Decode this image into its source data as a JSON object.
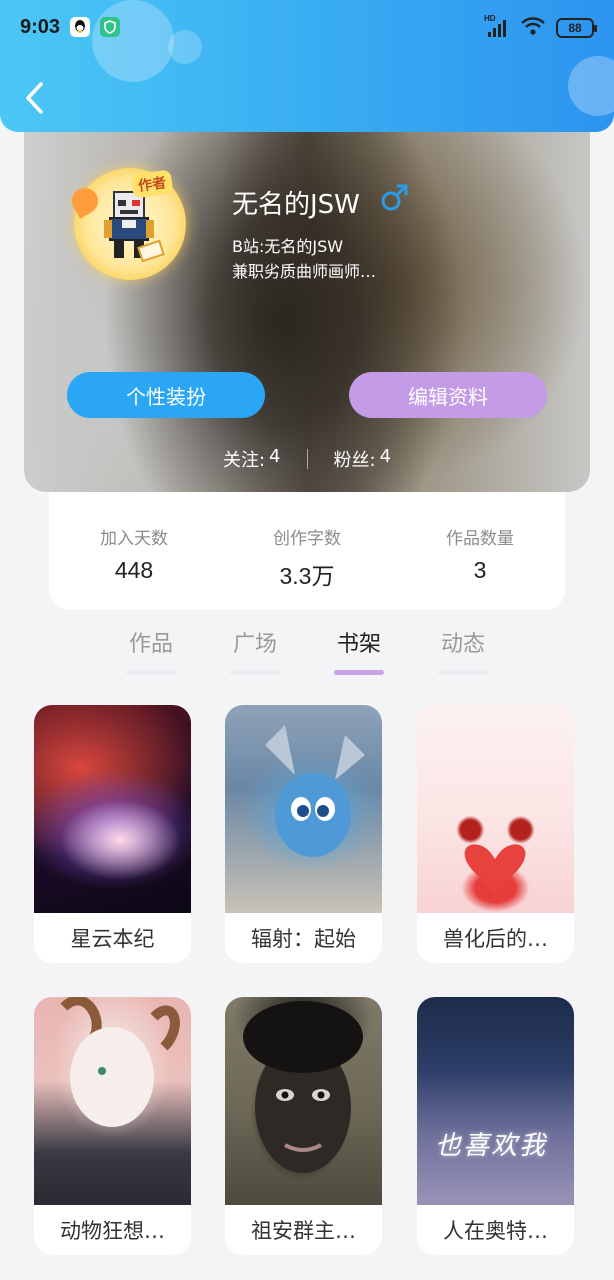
{
  "status_bar": {
    "time": "9:03",
    "network": "HD",
    "battery": "88"
  },
  "profile": {
    "author_tag": "作者",
    "name": "无名的JSW",
    "gender": "male",
    "bio_line1": "B站:无名的JSW",
    "bio_line2": "兼职劣质曲师画师…",
    "dress_button": "个性装扮",
    "edit_button": "编辑资料",
    "following_label": "关注:",
    "following_count": "4",
    "fans_label": "粉丝:",
    "fans_count": "4"
  },
  "stats": [
    {
      "label": "加入天数",
      "value": "448"
    },
    {
      "label": "创作字数",
      "value": "3.3万"
    },
    {
      "label": "作品数量",
      "value": "3"
    }
  ],
  "tabs": [
    {
      "label": "作品"
    },
    {
      "label": "广场"
    },
    {
      "label": "书架",
      "active": true
    },
    {
      "label": "动态"
    }
  ],
  "books": [
    {
      "title": "星云本纪"
    },
    {
      "title": "辐射：起始"
    },
    {
      "title": "兽化后的…"
    },
    {
      "title": "动物狂想…"
    },
    {
      "title": "祖安群主…"
    },
    {
      "title": "人在奥特…",
      "cover_text": "也喜欢我"
    }
  ],
  "colors": {
    "header_start": "#4cc7f5",
    "header_end": "#2d94f0",
    "dress_button": "#2aa6f5",
    "edit_button": "#c39be6",
    "active_tab_underline": "#c9a3ea"
  }
}
